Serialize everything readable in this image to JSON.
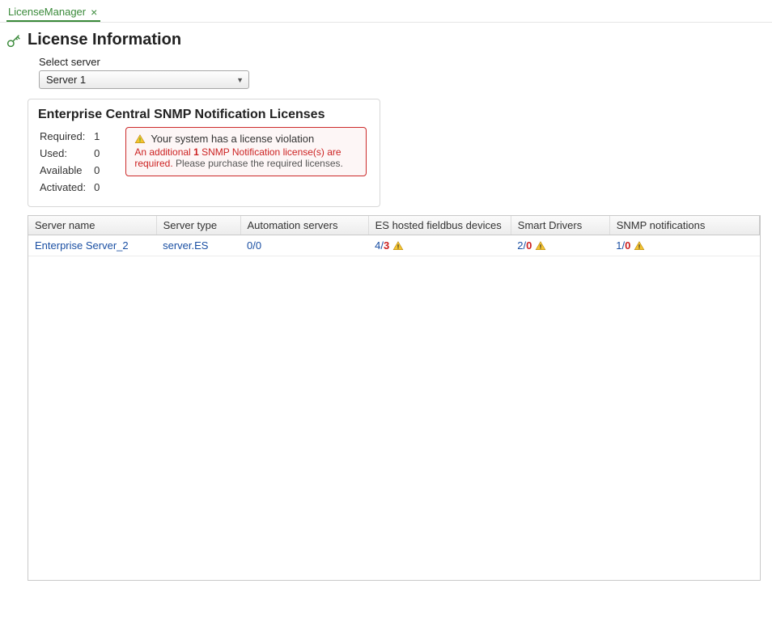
{
  "tab": {
    "label": "LicenseManager"
  },
  "header": {
    "title": "License Information"
  },
  "server_select": {
    "label": "Select server",
    "value": "Server 1"
  },
  "license_panel": {
    "title": "Enterprise Central SNMP Notification Licenses",
    "stats": {
      "required_label": "Required:",
      "required_value": "1",
      "used_label": "Used:",
      "used_value": "0",
      "available_label": "Available",
      "available_value": "0",
      "activated_label": "Activated:",
      "activated_value": "0"
    },
    "alert": {
      "headline": "Your system has a license violation",
      "line_prefix": "An additional ",
      "count": "1",
      "line_mid": "  SNMP Notification license(s) are required.",
      "line_suffix": " Please purchase the required licenses."
    }
  },
  "table": {
    "columns": {
      "c0": "Server name",
      "c1": "Server type",
      "c2": "Automation servers",
      "c3": "ES hosted fieldbus devices",
      "c4": "Smart Drivers",
      "c5": "SNMP notifications"
    },
    "rows": [
      {
        "name": "Enterprise Server_2",
        "type": "server.ES",
        "automation": "0/0",
        "fieldbus_a": "4/",
        "fieldbus_b": "3",
        "smart_a": "2/",
        "smart_b": "0",
        "snmp_a": "1/",
        "snmp_b": "0"
      }
    ]
  }
}
